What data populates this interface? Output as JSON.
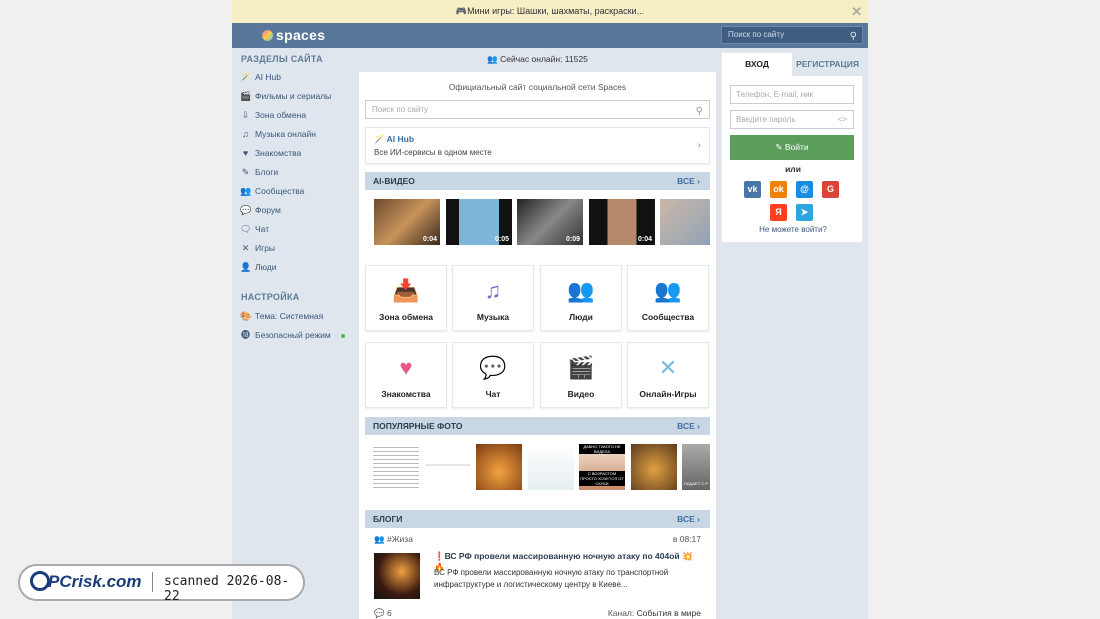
{
  "promo": {
    "text": "🎮Мини игры: Шашки, шахматы, раскраски..."
  },
  "header": {
    "logo": "spaces",
    "search_placeholder": "Поиск по сайту"
  },
  "sidebar": {
    "sections_title": "РАЗДЕЛЫ САЙТА",
    "items": [
      {
        "label": "AI Hub",
        "icon": "wand-icon",
        "glyph": "🪄"
      },
      {
        "label": "Фильмы и сериалы",
        "icon": "film-icon",
        "glyph": "🎬"
      },
      {
        "label": "Зона обмена",
        "icon": "download-icon",
        "glyph": "⇩"
      },
      {
        "label": "Музыка онлайн",
        "icon": "music-icon",
        "glyph": "♫"
      },
      {
        "label": "Знакомства",
        "icon": "heart-icon",
        "glyph": "♥"
      },
      {
        "label": "Блоги",
        "icon": "pen-icon",
        "glyph": "✎"
      },
      {
        "label": "Сообщества",
        "icon": "group-icon",
        "glyph": "👥"
      },
      {
        "label": "Форум",
        "icon": "forum-icon",
        "glyph": "💬"
      },
      {
        "label": "Чат",
        "icon": "chat-icon",
        "glyph": "🗨"
      },
      {
        "label": "Игры",
        "icon": "swords-icon",
        "glyph": "✕"
      },
      {
        "label": "Люди",
        "icon": "people-icon",
        "glyph": "👤"
      }
    ],
    "settings_title": "НАСТРОЙКА",
    "settings": [
      {
        "label": "Тема: Системная",
        "icon": "palette-icon",
        "glyph": "🎨"
      },
      {
        "label": "Безопасный режим",
        "icon": "age18-icon",
        "glyph": "⓲"
      }
    ]
  },
  "main": {
    "online": "Сейчас онлайн: 11525",
    "subtitle": "Официальный сайт социальной сети Spaces",
    "search_placeholder": "Поиск по сайту",
    "aihub_title": "AI Hub",
    "aihub_desc": "Все ИИ-сервисы в одном месте",
    "ai_video_title": "AI-ВИДЕО",
    "all_label": "ВСЕ",
    "videos": [
      "0:04",
      "0:05",
      "0:09",
      "0:04"
    ],
    "tiles": [
      {
        "label": "Зона обмена",
        "icon": "download-box-icon",
        "glyph": "📥",
        "color": "#f2b84b"
      },
      {
        "label": "Музыка",
        "icon": "music-note-icon",
        "glyph": "♫",
        "color": "#8a62c7"
      },
      {
        "label": "Люди",
        "icon": "people-icon",
        "glyph": "👥",
        "color": "#6d95c6"
      },
      {
        "label": "Сообщества",
        "icon": "community-icon",
        "glyph": "👥",
        "color": "#86c46a"
      },
      {
        "label": "Знакомства",
        "icon": "heart-icon",
        "glyph": "♥",
        "color": "#e85a86"
      },
      {
        "label": "Чат",
        "icon": "chat-bubbles-icon",
        "glyph": "💬",
        "color": "#64c9c3"
      },
      {
        "label": "Видео",
        "icon": "clapper-icon",
        "glyph": "🎬",
        "color": "#6d95c6"
      },
      {
        "label": "Онлайн-Игры",
        "icon": "crossed-swords-icon",
        "glyph": "✕",
        "color": "#7bb8de"
      }
    ],
    "photos_title": "ПОПУЛЯРНЫЕ ФОТО",
    "photo_captions": [
      "ДАВНО ТАКОГО НЕ ВИДЕЛА",
      "С ВОЗРАСТОМ ПРОСТО ХОЧЕТСЯ ОТ СКУКИ",
      "ПАДАЕТ С Р"
    ],
    "blogs_title": "БЛОГИ",
    "blog": {
      "tag": "#Жиза",
      "time": "в 08:17",
      "title": "❗ВС РФ провели массированную ночную атаку по 404ой 💥🔥",
      "excerpt": "ВС РФ провели массированную ночную атаку по транспортной инфраструктуре и логистическому центру в Киеве...",
      "comments": "6",
      "channel_label": "Канал:",
      "channel": "События в мире"
    }
  },
  "auth": {
    "tab_login": "ВХОД",
    "tab_register": "РЕГИСТРАЦИЯ",
    "login_placeholder": "Телефон, E-mail, ник",
    "password_placeholder": "Введите пароль",
    "login_button": "Войти",
    "or": "или",
    "cant_login": "Не можете войти?",
    "socials": [
      {
        "name": "vk-icon",
        "glyph": "vk",
        "color": "#4a76a8"
      },
      {
        "name": "odnoklassniki-icon",
        "glyph": "ok",
        "color": "#ee8208"
      },
      {
        "name": "mailru-icon",
        "glyph": "@",
        "color": "#168de2"
      },
      {
        "name": "google-icon",
        "glyph": "G",
        "color": "#db4437"
      },
      {
        "name": "yandex-icon",
        "glyph": "Я",
        "color": "#fc3f1d"
      },
      {
        "name": "telegram-icon",
        "glyph": "➤",
        "color": "#2ca5e0"
      }
    ]
  },
  "watermark": {
    "logo": "PCrisk.com",
    "scanned": "scanned 2026-08-22"
  }
}
